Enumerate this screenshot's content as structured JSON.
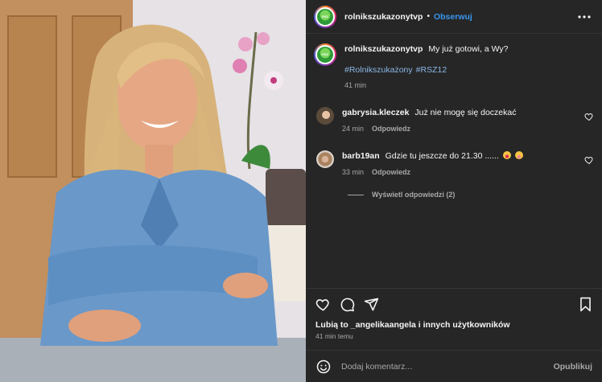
{
  "photo": {
    "subject": "woman-in-denim-jacket"
  },
  "header": {
    "account": "rolnikszukazonytvp",
    "separator": "•",
    "follow_label": "Obserwuj",
    "more_icon": "ellipsis-icon"
  },
  "caption": {
    "username": "rolnikszukazonytvp",
    "text": "My już gotowi, a Wy?",
    "hashtags": [
      "#Rolnikszukażony",
      "#RSZ12"
    ],
    "time": "41 min"
  },
  "comments": [
    {
      "username": "gabrysia.kleczek",
      "text": "Już nie mogę się doczekać",
      "time": "24 min",
      "reply_label": "Odpowiedz"
    },
    {
      "username": "barb19an",
      "text": "Gdzie tu jeszcze do 21.30 ......",
      "time": "33 min",
      "reply_label": "Odpowiedz"
    }
  ],
  "view_replies_label": "Wyświetl odpowiedzi (2)",
  "actions": {
    "like": "heart-icon",
    "comment": "comment-icon",
    "share": "send-icon",
    "save": "bookmark-icon"
  },
  "likes_text": "Lubią to _angelikaangela i innych użytkowników",
  "post_time": "41 min temu",
  "composer": {
    "placeholder": "Dodaj komentarz...",
    "post_label": "Opublikuj"
  },
  "colors": {
    "panel_bg": "#262626",
    "link_blue": "#3897f0",
    "muted": "#a8a8a8"
  }
}
